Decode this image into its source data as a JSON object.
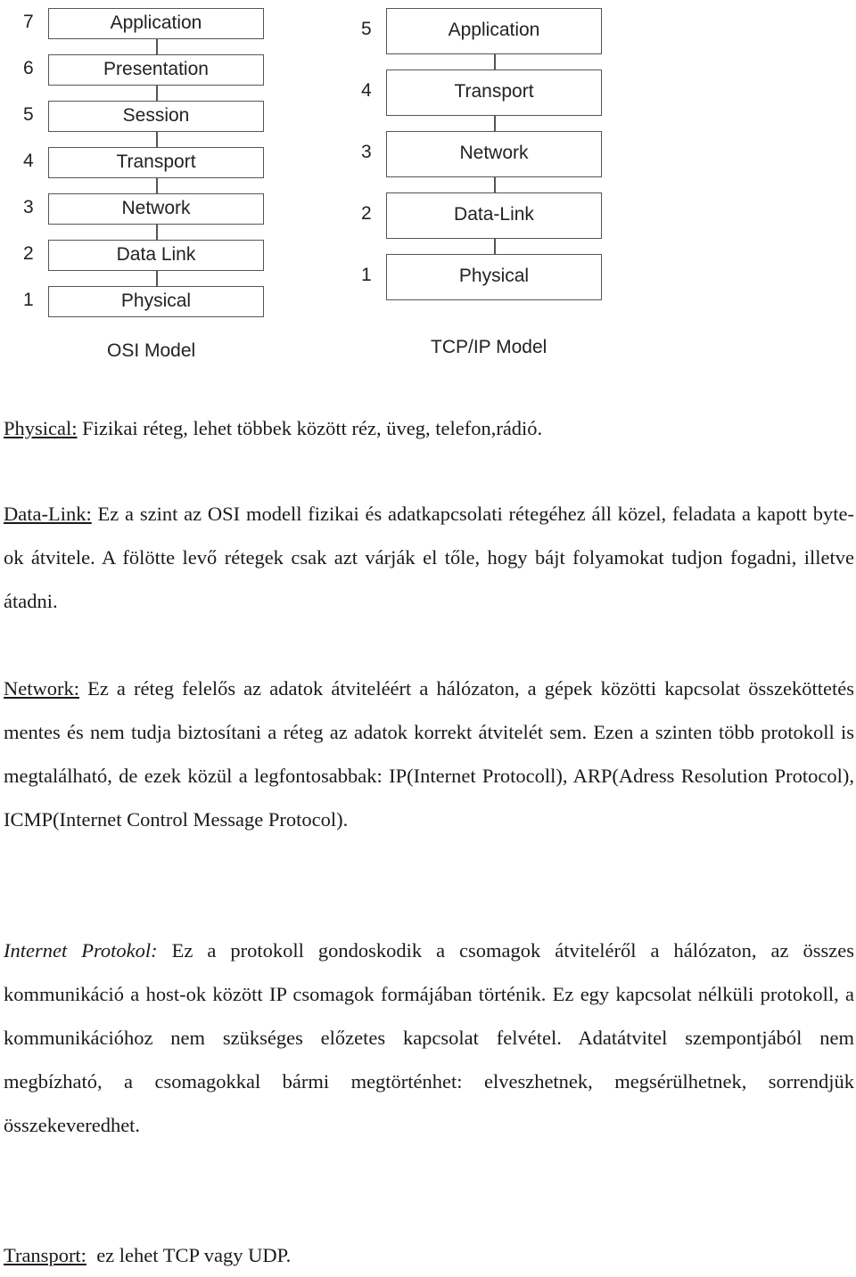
{
  "osi_model": {
    "caption": "OSI Model",
    "layers": [
      {
        "number": "7",
        "name": "Application"
      },
      {
        "number": "6",
        "name": "Presentation"
      },
      {
        "number": "5",
        "name": "Session"
      },
      {
        "number": "4",
        "name": "Transport"
      },
      {
        "number": "3",
        "name": "Network"
      },
      {
        "number": "2",
        "name": "Data Link"
      },
      {
        "number": "1",
        "name": "Physical"
      }
    ]
  },
  "tcpip_model": {
    "caption": "TCP/IP Model",
    "layers": [
      {
        "number": "5",
        "name": "Application"
      },
      {
        "number": "4",
        "name": "Transport"
      },
      {
        "number": "3",
        "name": "Network"
      },
      {
        "number": "2",
        "name": "Data-Link"
      },
      {
        "number": "1",
        "name": "Physical"
      }
    ]
  },
  "sections": {
    "physical": {
      "term": "Physical:",
      "text": " Fizikai réteg, lehet többek között réz, üveg, telefon,rádió."
    },
    "data_link": {
      "term": "Data-Link:",
      "text": " Ez a szint az OSI modell fizikai és adatkapcsolati rétegéhez áll közel, feladata a kapott byte-ok átvitele. A fölötte levő rétegek csak azt várják el tőle, hogy bájt folyamokat tudjon fogadni, illetve átadni."
    },
    "network": {
      "term": "Network:",
      "text": " Ez a réteg felelős az adatok átviteléért a hálózaton, a gépek közötti kapcsolat összeköttetés mentes és nem tudja biztosítani a réteg az adatok korrekt átvitelét sem. Ezen a szinten több protokoll is megtalálható, de ezek közül a legfontosabbak: IP(Internet Protocoll), ARP(Adress Resolution Protocol), ICMP(Internet Control Message Protocol)."
    },
    "internet_protocol": {
      "term": "Internet Protokol:",
      "text": " Ez a protokoll gondoskodik a csomagok átviteléről a hálózaton, az összes kommunikáció a host-ok között IP csomagok formájában történik. Ez egy kapcsolat nélküli protokoll, a kommunikációhoz nem szükséges előzetes kapcsolat felvétel. Adatátvitel szempontjából nem megbízható, a csomagokkal bármi megtörténhet: elveszhetnek, megsérülhetnek, sorrendjük összekeveredhet."
    },
    "transport": {
      "term": "Transport:",
      "text": "  ez lehet TCP vagy UDP."
    }
  }
}
